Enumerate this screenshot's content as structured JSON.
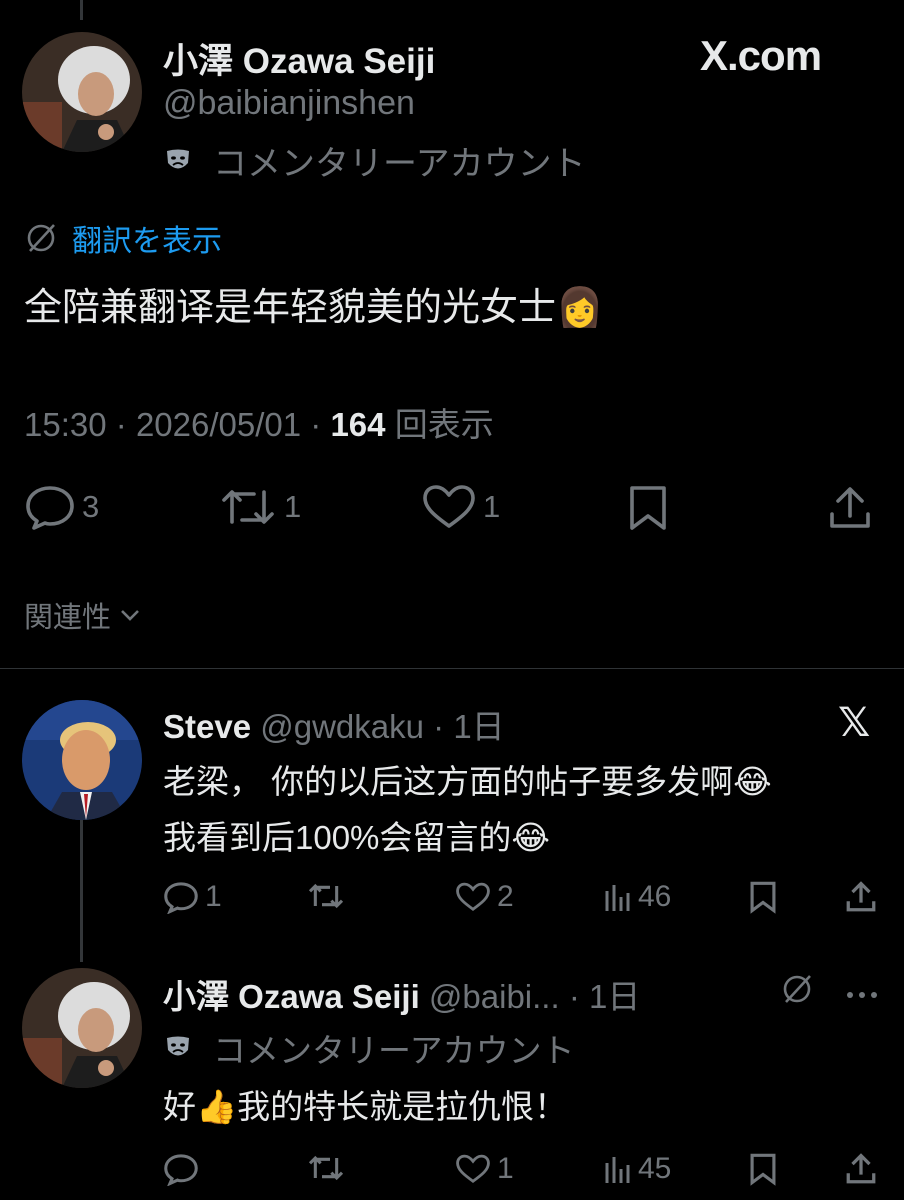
{
  "site_logo": "X.com",
  "main_post": {
    "display_name": "小澤 Ozawa Seiji",
    "handle": "@baibianjinshen",
    "account_label": "コメンタリーアカウント",
    "account_icon": "theater-mask-icon",
    "translate_label": "翻訳を表示",
    "text": "全陪兼翻译是年轻貌美的光女士",
    "text_emoji": "👩",
    "time": "15:30",
    "date": "2026/05/01",
    "views": "164",
    "views_label": "回表示",
    "replies": "3",
    "reposts": "1",
    "likes": "1"
  },
  "sort": {
    "label": "関連性"
  },
  "replies": [
    {
      "display_name": "Steve",
      "handle": "@gwdkaku",
      "age": "1日",
      "line1": "老梁， 你的以后这方面的帖子要多发啊",
      "line2": "我看到后100%会留言的",
      "emoji": "😂",
      "replies": "1",
      "reposts": "",
      "likes": "2",
      "views": "46"
    },
    {
      "display_name": "小澤 Ozawa Seiji",
      "handle": "@baibi...",
      "age": "1日",
      "account_label": "コメンタリーアカウント",
      "text_a": "好",
      "emoji": "👍",
      "text_b": "我的特长就是拉仇恨！",
      "replies": "",
      "reposts": "",
      "likes": "1",
      "views": "45"
    }
  ]
}
